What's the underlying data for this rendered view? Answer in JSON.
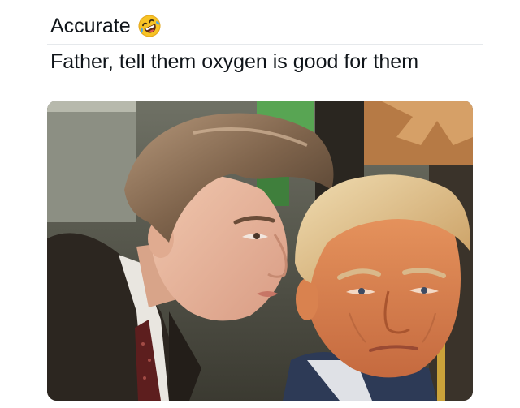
{
  "post": {
    "header_text": "Accurate",
    "header_emoji_icon": "rolling-on-floor-laughing-icon",
    "body_text": "Father, tell them oxygen is good for them"
  },
  "colors": {
    "text": "#0f1419",
    "divider": "#e6e9ec"
  }
}
